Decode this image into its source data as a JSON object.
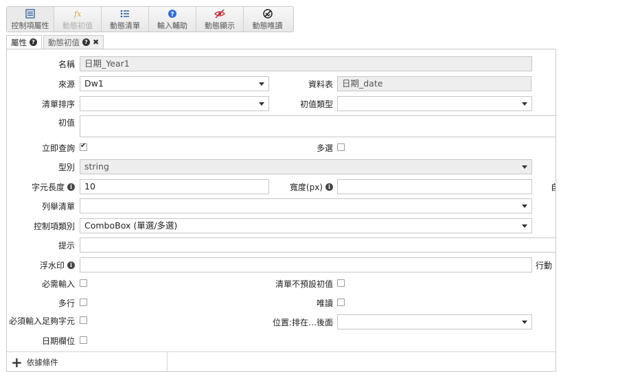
{
  "toolbar": {
    "buttons": [
      {
        "label": "控制項屬性",
        "icon": "list-icon"
      },
      {
        "label": "動態初值",
        "icon": "fx-icon"
      },
      {
        "label": "動態清單",
        "icon": "bulleted-list-icon"
      },
      {
        "label": "輸入輔助",
        "icon": "help-icon"
      },
      {
        "label": "動態顯示",
        "icon": "hidden-eye-icon"
      },
      {
        "label": "動態唯讀",
        "icon": "readonly-icon"
      }
    ]
  },
  "tabs": [
    {
      "label": "屬性"
    },
    {
      "label": "動態初值"
    }
  ],
  "form": {
    "name_label": "名稱",
    "name_value": "日期_Year1",
    "source_label": "來源",
    "source_value": "Dw1",
    "table_label": "資料表",
    "table_value": "日期_date",
    "list_sort_label": "清單排序",
    "list_sort_value": "",
    "init_type_label": "初值類型",
    "init_type_value": "",
    "init_label": "初值",
    "init_value": "",
    "instant_query_label": "立即查詢",
    "instant_query_checked": true,
    "multi_select_label": "多選",
    "multi_select_checked": false,
    "type_label": "型別",
    "type_value": "string",
    "char_len_label": "字元長度",
    "char_len_value": "10",
    "width_label": "寬度(px)",
    "width_value": "",
    "right_clip_1": "自",
    "enum_list_label": "列舉清單",
    "enum_list_value": "",
    "control_type_label": "控制項類別",
    "control_type_value": "ComboBox (單選/多選)",
    "hint_label": "提示",
    "hint_value": "",
    "watermark_label": "浮水印",
    "watermark_value": "",
    "right_clip_2": "行動",
    "required_label": "必需輸入",
    "no_default_label": "清單不預設初值",
    "multiline_label": "多行",
    "readonly_label": "唯讀",
    "must_fill_label": "必須輸入足夠字元",
    "position_label": "位置:排在…後面",
    "position_value": "",
    "date_field_label": "日期欄位"
  },
  "footer": {
    "condition_label": "依據條件"
  },
  "colors": {
    "highlight": "#e31e24",
    "readonly_bg": "#eeeeee"
  }
}
